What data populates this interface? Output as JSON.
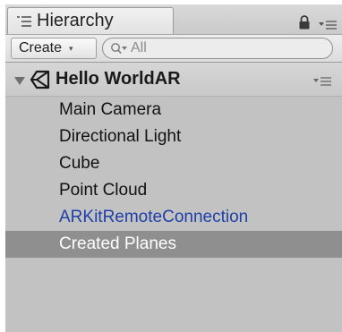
{
  "window": {
    "tab_title": "Hierarchy",
    "tab_icon": "list-icon",
    "lock_icon": "lock-icon",
    "menu_icon": "panel-menu-icon"
  },
  "toolbar": {
    "create_label": "Create",
    "create_caret": "▾",
    "search_placeholder": "All",
    "search_value": ""
  },
  "scene": {
    "name": "Hello WorldAR",
    "expanded": true,
    "icon": "unity-logo-icon"
  },
  "hierarchy": {
    "items": [
      {
        "label": "Main Camera",
        "state": "normal"
      },
      {
        "label": "Directional Light",
        "state": "normal"
      },
      {
        "label": "Cube",
        "state": "normal"
      },
      {
        "label": "Point Cloud",
        "state": "normal"
      },
      {
        "label": "ARKitRemoteConnection",
        "state": "prefab"
      },
      {
        "label": "Created Planes",
        "state": "selected"
      }
    ]
  },
  "colors": {
    "prefab_text": "#1f3fa8",
    "selection_bg": "#8f8f8f",
    "panel_bg": "#c2c2c2"
  }
}
